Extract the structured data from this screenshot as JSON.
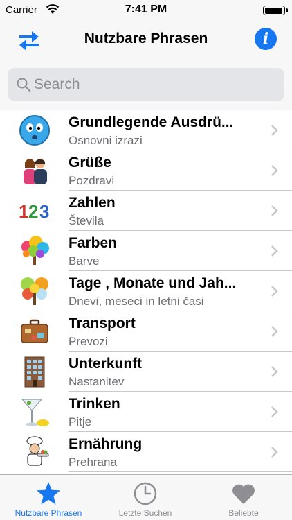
{
  "status_bar": {
    "carrier": "Carrier",
    "time": "7:41 PM",
    "battery_level": 0.95
  },
  "nav_bar": {
    "title": "Nutzbare Phrasen",
    "left_icon": "swap-arrows-icon",
    "right_icon": "info-icon",
    "info_glyph": "i"
  },
  "search": {
    "placeholder": "Search",
    "value": ""
  },
  "categories": [
    {
      "title": "Grundlegende Ausdrü...",
      "subtitle": "Osnovni izrazi",
      "icon": "blue-face-icon"
    },
    {
      "title": "Grüße",
      "subtitle": "Pozdravi",
      "icon": "greeting-people-icon"
    },
    {
      "title": "Zahlen",
      "subtitle": "Števila",
      "icon": "numbers-icon",
      "icon_text": "123"
    },
    {
      "title": "Farben",
      "subtitle": "Barve",
      "icon": "colorful-tree-icon"
    },
    {
      "title": "Tage , Monate und Jah...",
      "subtitle": "Dnevi, meseci in letni časi",
      "icon": "seasons-tree-icon"
    },
    {
      "title": "Transport",
      "subtitle": "Prevozi",
      "icon": "suitcase-icon"
    },
    {
      "title": "Unterkunft",
      "subtitle": "Nastanitev",
      "icon": "building-icon"
    },
    {
      "title": "Trinken",
      "subtitle": "Pitje",
      "icon": "cocktail-icon"
    },
    {
      "title": "Ernährung",
      "subtitle": "Prehrana",
      "icon": "chef-icon"
    }
  ],
  "tab_bar": {
    "tabs": [
      {
        "label": "Nutzbare Phrasen",
        "icon": "star-icon",
        "selected": true
      },
      {
        "label": "Letzte Suchen",
        "icon": "clock-icon",
        "selected": false
      },
      {
        "label": "Beliebte",
        "icon": "heart-icon",
        "selected": false
      }
    ]
  },
  "colors": {
    "accent": "#1677f0",
    "inactive": "#8e8e93",
    "numbers_1": "#d0342c",
    "numbers_2": "#2e9a3e",
    "numbers_3": "#2a64c8"
  }
}
